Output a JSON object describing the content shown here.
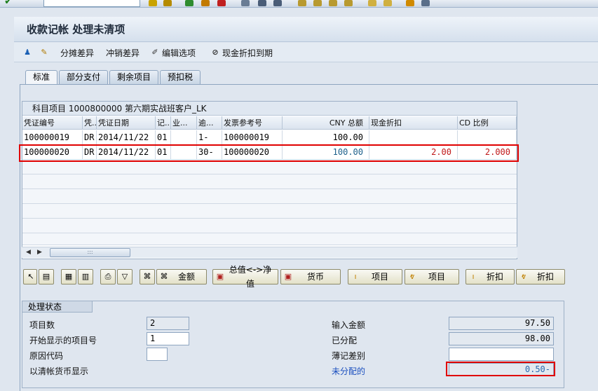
{
  "window": {
    "title": "收款记帐 处理未清项"
  },
  "app_toolbar": {
    "items": [
      {
        "label": "分摊差异"
      },
      {
        "label": "冲销差异"
      },
      {
        "label": "编辑选项"
      },
      {
        "label": "现金折扣到期"
      }
    ]
  },
  "tabs": [
    {
      "label": "标准",
      "active": true
    },
    {
      "label": "部分支付",
      "active": false
    },
    {
      "label": "剩余项目",
      "active": false
    },
    {
      "label": "预扣税",
      "active": false
    }
  ],
  "table": {
    "title": "科目项目 1000800000 第六期实战班客户_LK",
    "columns": [
      "凭证编号",
      "凭...",
      "凭证日期",
      "记...",
      "业...",
      "逾...",
      "发票参考号",
      "CNY 总额",
      "现金折扣",
      "CD 比例"
    ],
    "rows": [
      {
        "doc_no": "100000019",
        "doc_type": "DR",
        "date": "2014/11/22",
        "pk": "01",
        "ba": "",
        "days": "1-",
        "ref": "100000019",
        "amount": "100.00",
        "cash_disc": "",
        "cd_pct": ""
      },
      {
        "doc_no": "100000020",
        "doc_type": "DR",
        "date": "2014/11/22",
        "pk": "01",
        "ba": "",
        "days": "30-",
        "ref": "100000020",
        "amount": "100.00",
        "cash_disc": "2.00",
        "cd_pct": "2.000"
      }
    ]
  },
  "buttons": {
    "amount": "金额",
    "gross_net": "总值<->净值",
    "currency": "货币",
    "item1": "项目",
    "item2": "项目",
    "disc1": "折扣",
    "disc2": "折扣"
  },
  "status": {
    "title": "处理状态",
    "item_count_label": "项目数",
    "item_count": "2",
    "first_item_label": "开始显示的项目号",
    "first_item": "1",
    "reason_label": "原因代码",
    "reason": "",
    "currency_label": "以清帐货币显示",
    "input_amount_label": "输入金额",
    "input_amount": "97.50",
    "assigned_label": "已分配",
    "assigned": "98.00",
    "diff_label": "薄记差别",
    "diff": "",
    "unassigned_label": "未分配的",
    "unassigned": "0.50-"
  },
  "colors": {
    "highlight": "#e00000",
    "link_blue": "#1b4fbf"
  },
  "icons": [
    "check-icon",
    "save-icon",
    "back-icon",
    "exit-icon",
    "cancel-icon",
    "print-icon",
    "find-icon",
    "help-icon",
    "person-icon",
    "edit-icon",
    "pencil-icon",
    "cash-discount-icon"
  ]
}
